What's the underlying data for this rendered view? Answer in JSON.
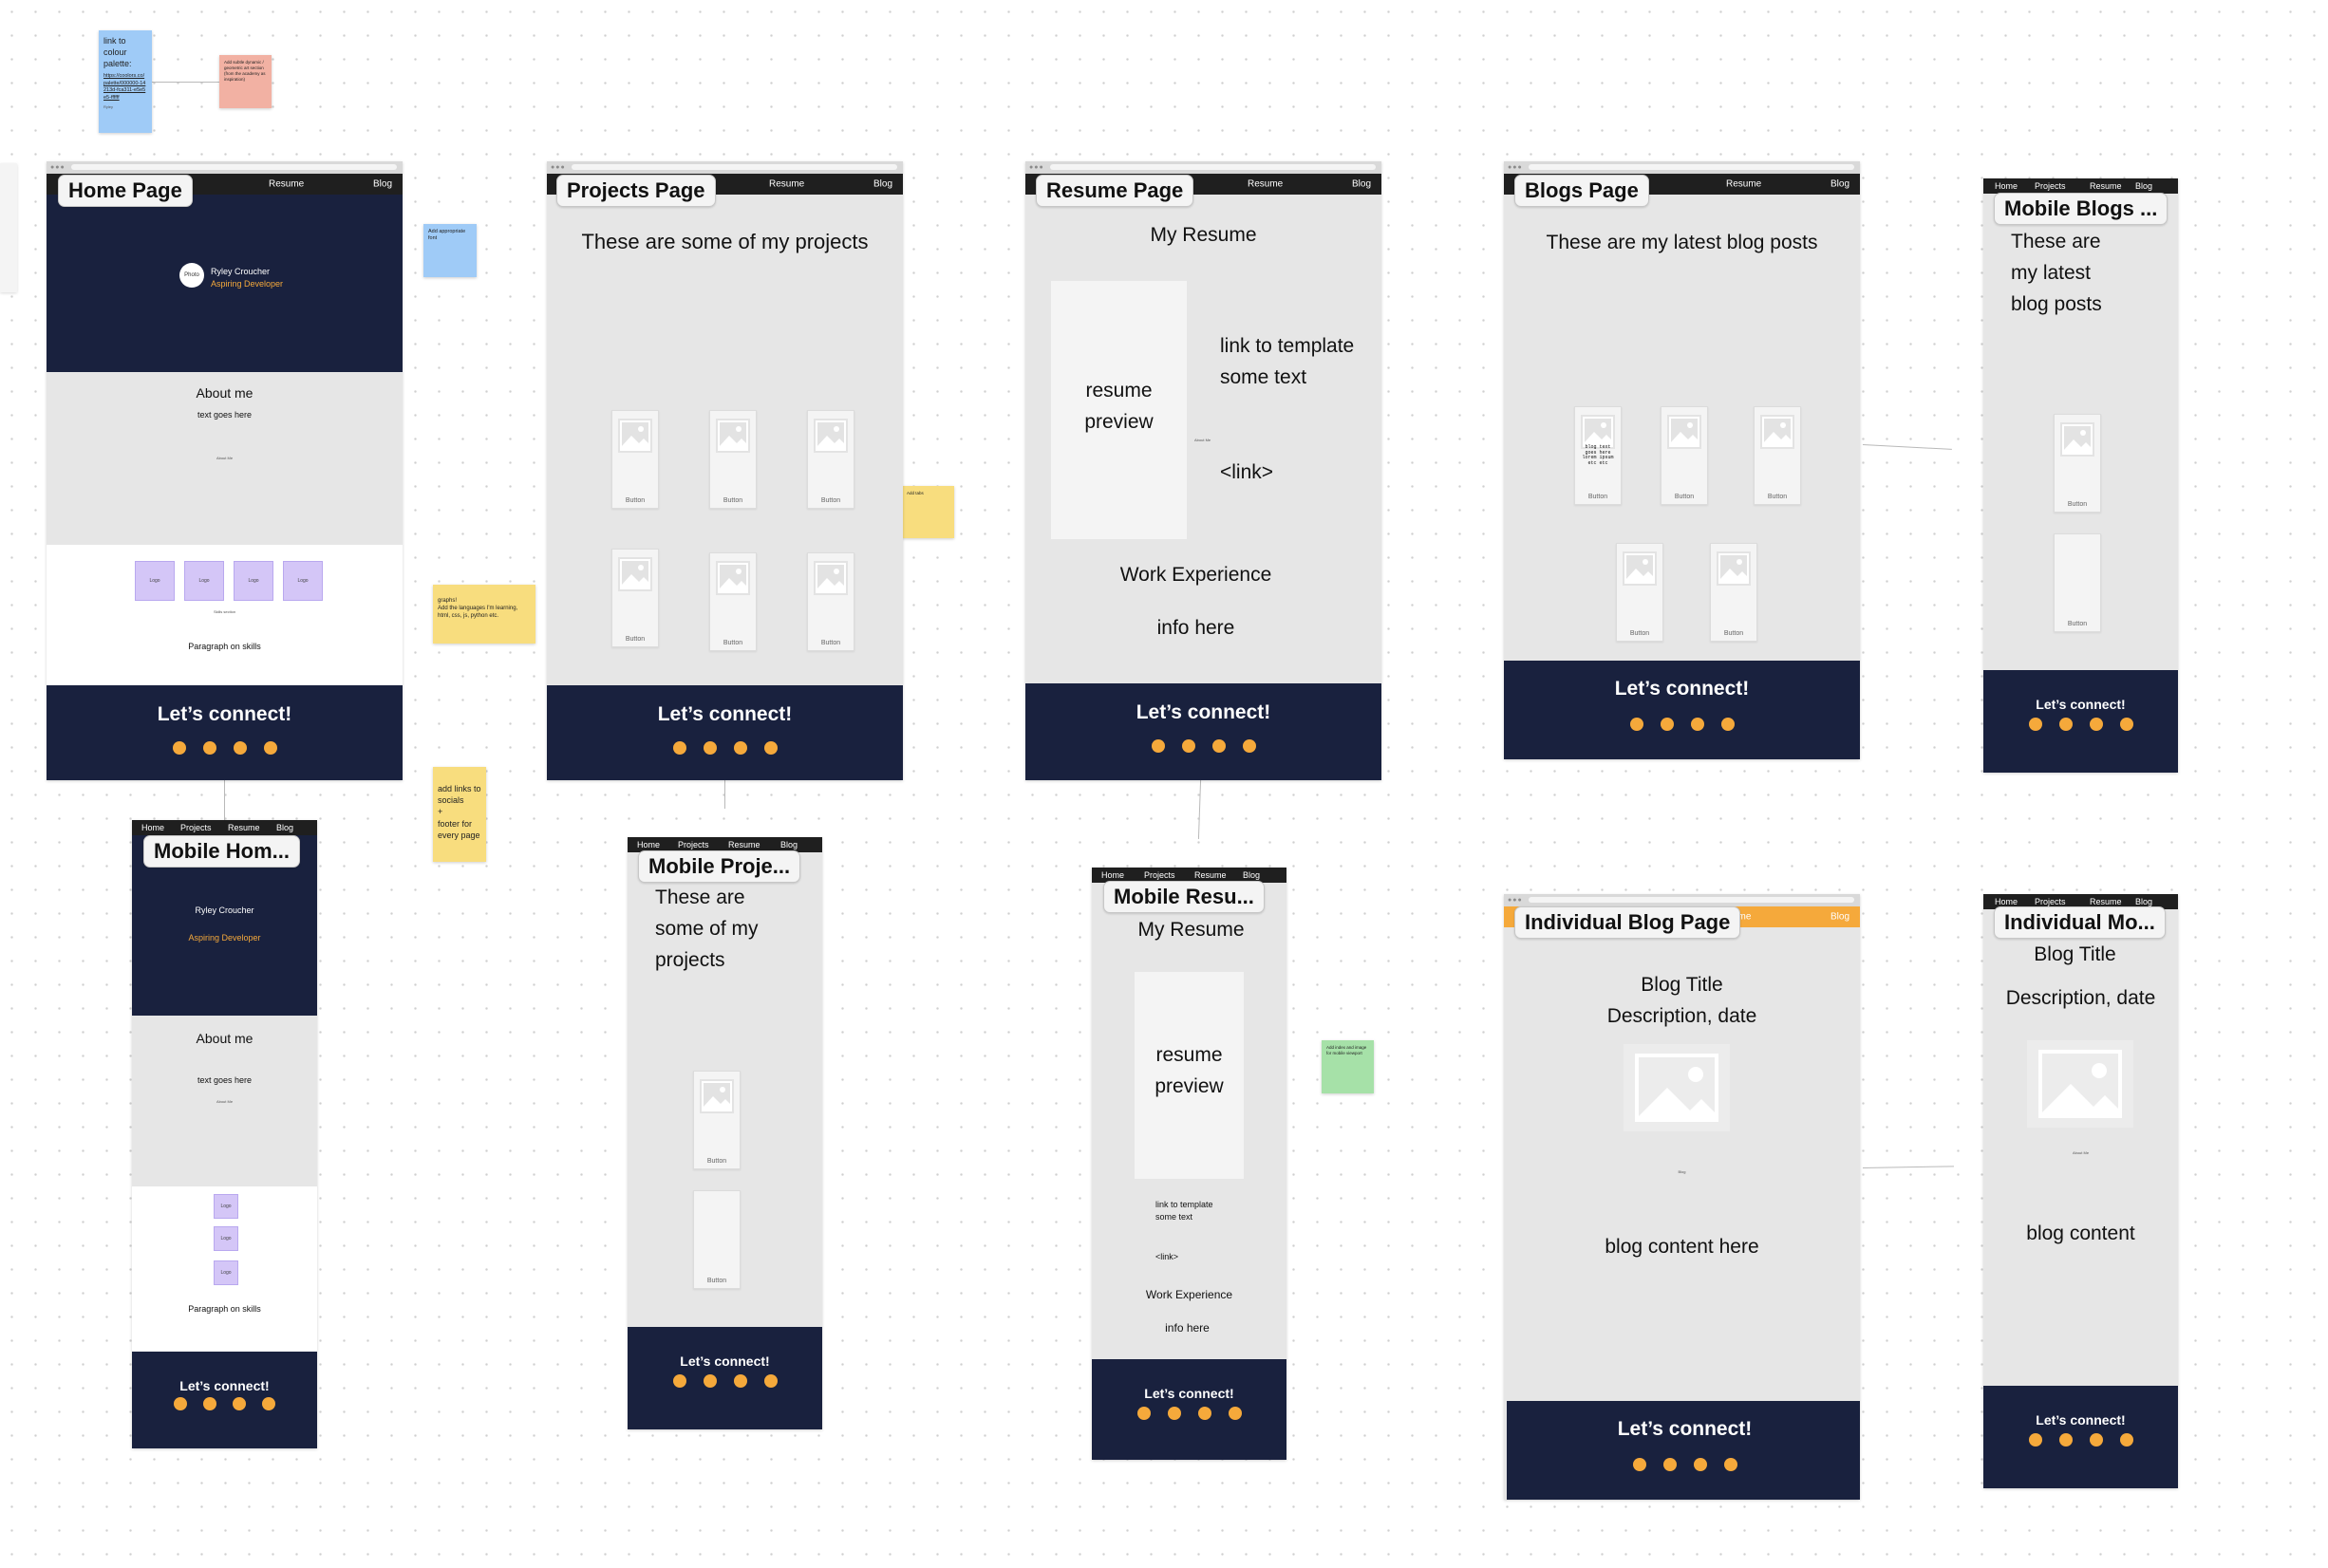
{
  "colors": {
    "canvas": "#ffffff",
    "frame_bg": "#e6e6e6",
    "navy": "#19213e",
    "orange": "#f5a93b",
    "navbar": "#1f1f1f",
    "sticky_blue": "#9fcbf7",
    "sticky_pink": "#f2b1a3",
    "sticky_yellow": "#f8dd7e",
    "sticky_green": "#a6e1a8",
    "skill_purple": "#d4c6f7"
  },
  "nav": {
    "home": "Home",
    "projects": "Projects",
    "resume": "Resume",
    "blog": "Blog",
    "partial_ts": "ts",
    "partial_sume": "sume"
  },
  "footer": {
    "title": "Let’s connect!",
    "social_dot_icon": "circle-icon"
  },
  "image_placeholder_icon": "image-icon",
  "frames": {
    "home": {
      "label": "Home Page",
      "avatar_text": "Photo",
      "name": "Ryley Croucher",
      "role": "Aspiring Developer",
      "about_title": "About me",
      "about_text": "text goes here",
      "about_small": "About Me",
      "skills": [
        "Logo",
        "Logo",
        "Logo",
        "Logo"
      ],
      "skills_caption": "Skills section",
      "skills_paragraph": "Paragraph on skills"
    },
    "projects": {
      "label": "Projects Page",
      "heading": "These are some of my projects",
      "cards": [
        "Button",
        "Button",
        "Button",
        "Button",
        "Button",
        "Button"
      ]
    },
    "resume": {
      "label": "Resume Page",
      "heading": "My Resume",
      "preview_line1": "resume",
      "preview_line2": "preview",
      "link_line1": "link to template",
      "link_line2": "some text",
      "small_label": "About Me",
      "link": "<link>",
      "work": "Work Experience",
      "info": "info here"
    },
    "blogs": {
      "label": "Blogs Page",
      "heading": "These are my latest blog posts",
      "first_card_text": "blog text goes here lorem ipsum etc etc",
      "cards": [
        "Button",
        "Button",
        "Button",
        "Button",
        "Button"
      ]
    },
    "mobile_blogs": {
      "label": "Mobile Blogs ...",
      "heading_lines": [
        "These are",
        "my latest",
        "blog posts"
      ],
      "cards": [
        "Button",
        "Button"
      ]
    },
    "mobile_home": {
      "label": "Mobile Hom...",
      "name": "Ryley Croucher",
      "role": "Aspiring Developer",
      "about_title": "About me",
      "about_text": "text goes here",
      "about_small": "About Me",
      "skills": [
        "Logo",
        "Logo",
        "Logo"
      ],
      "skills_paragraph": "Paragraph on skills"
    },
    "mobile_projects": {
      "label": "Mobile Proje...",
      "heading_lines": [
        "These are",
        "some of my",
        "projects"
      ],
      "cards": [
        "Button",
        "Button"
      ]
    },
    "mobile_resume": {
      "label": "Mobile Resu...",
      "heading": "My Resume",
      "preview_line1": "resume",
      "preview_line2": "preview",
      "link_line1": "link to template",
      "link_line2": "some text",
      "link": "<link>",
      "work": "Work Experience",
      "info": "info here"
    },
    "individual_blog": {
      "label": "Individual Blog Page",
      "title": "Blog Title",
      "description": "Description, date",
      "small_label": "Blog",
      "content": "blog content here"
    },
    "individual_mobile": {
      "label": "Individual Mo...",
      "title": "Blog Title",
      "description": "Description, date",
      "small_label": "About Me",
      "content": "blog content"
    }
  },
  "stickies": {
    "palette": {
      "text": "link to colour palette:",
      "link": "https://coolors.co/palette/000000-14213d-fca311-e5e5e5-ffffff",
      "author": "Ryley"
    },
    "pink": "Add subtle dynamic / geometric art section (from the academy as inspiration)",
    "font": "Add appropriate font",
    "graphs": "graphs!\nAdd the languages I'm learning, html, css, js, python etc.",
    "projects_note": "Add tabs",
    "footer_links": "add links to socials\n+\nfooter for every page",
    "green": "Add index and image for mobile viewport"
  }
}
